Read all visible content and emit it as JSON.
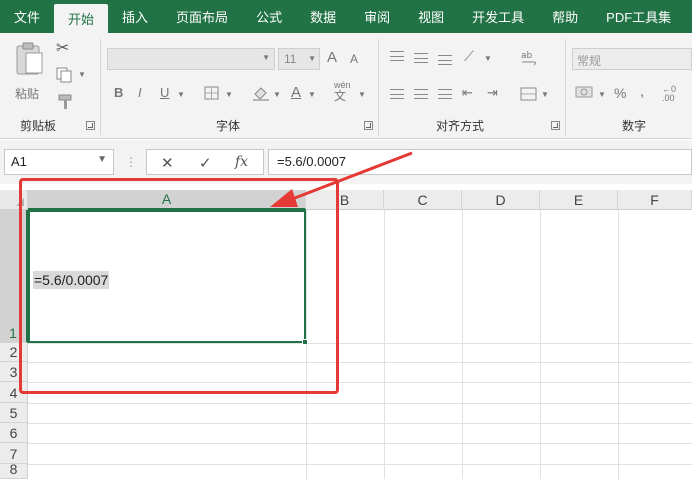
{
  "tabs": [
    "文件",
    "开始",
    "插入",
    "页面布局",
    "公式",
    "数据",
    "审阅",
    "视图",
    "开发工具",
    "帮助",
    "PDF工具集"
  ],
  "active_tab_index": 1,
  "ribbon": {
    "clipboard": {
      "label": "剪贴板",
      "paste_label": "粘贴"
    },
    "font": {
      "label": "字体",
      "font_size": "11",
      "bold": "B",
      "italic": "I",
      "underline": "U",
      "grow": "A",
      "shrink": "A",
      "color_a": "A",
      "wen": "wén",
      "wen_char": "文"
    },
    "alignment": {
      "label": "对齐方式"
    },
    "number": {
      "label": "数字",
      "format": "常规",
      "percent": "%",
      "comma": ","
    }
  },
  "formula_bar": {
    "name_box": "A1",
    "cancel": "✕",
    "enter": "✓",
    "fx": "fx",
    "formula": "=5.6/0.0007"
  },
  "grid": {
    "columns": [
      "A",
      "B",
      "C",
      "D",
      "E",
      "F"
    ],
    "rows": [
      "1",
      "2",
      "3",
      "4",
      "5",
      "6",
      "7",
      "8"
    ],
    "selected_cell": "A1",
    "cell_a1_text": "=5.6/0.0007"
  },
  "colors": {
    "excel_green": "#217346",
    "annotation_red": "#e53935"
  }
}
